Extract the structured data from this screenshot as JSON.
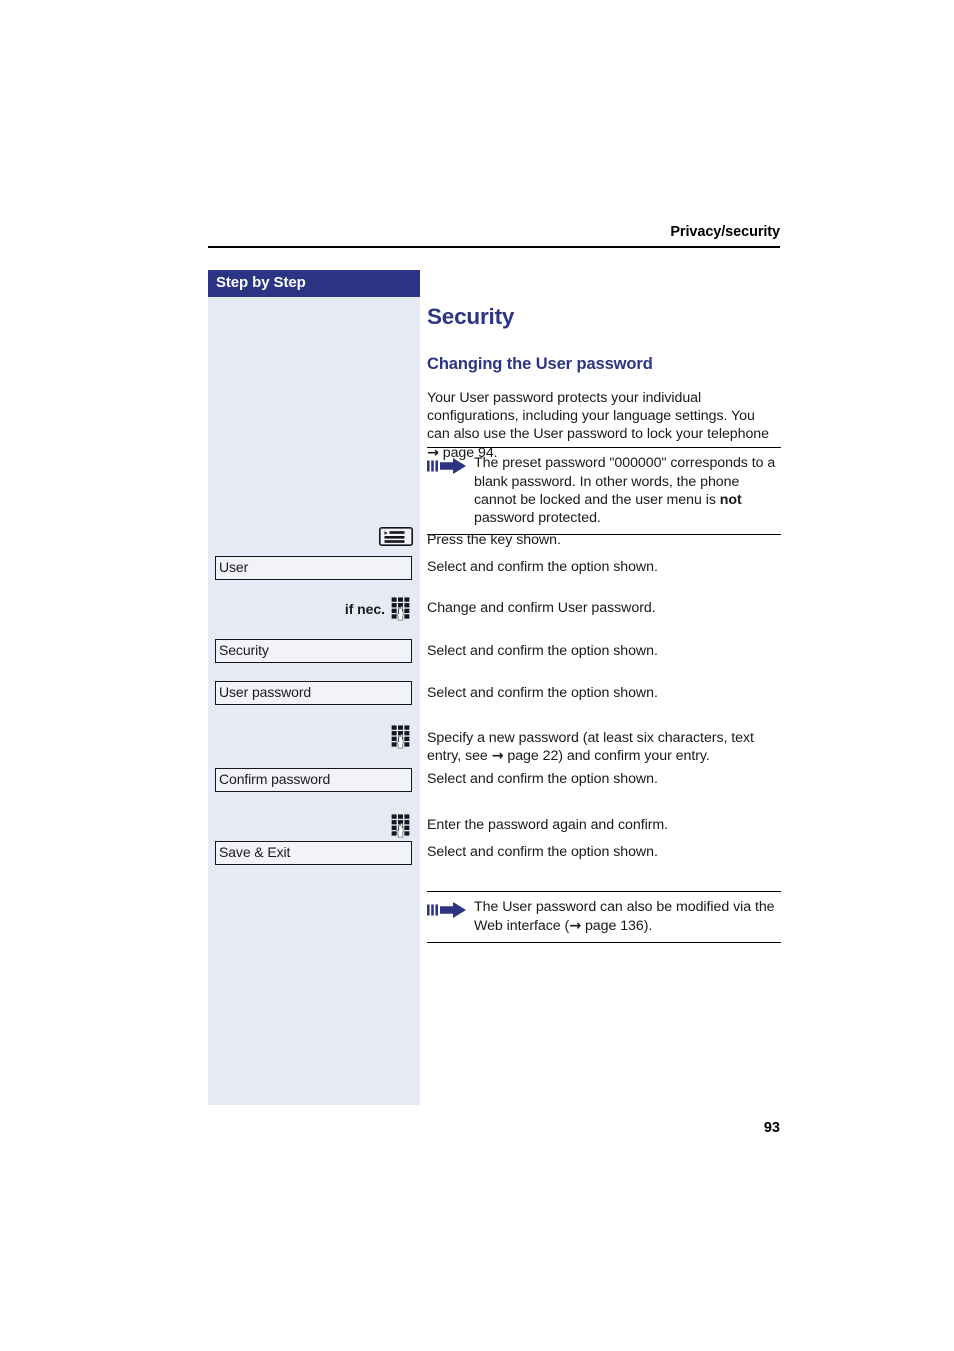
{
  "document": {
    "running_header": "Privacy/security",
    "page_number": "93",
    "accent_color": "#2b3584",
    "sidebar_bg": "#e6eaf5"
  },
  "sidebar": {
    "title": "Step by Step"
  },
  "main": {
    "heading": "Security",
    "subheading": "Changing the User password",
    "intro_paragraph": "Your User password protects your individual configurations, including your language settings. You can also use the User password to lock your telephone → page 94.",
    "notes": [
      {
        "icon": "blue-arrow-icon",
        "text_parts": [
          {
            "text": "The preset password \"000000\" corresponds to a blank password. In other words, the phone cannot be locked and the user menu is ",
            "bold": false
          },
          {
            "text": "not",
            "bold": true
          },
          {
            "text": " password protected.",
            "bold": false
          }
        ],
        "text": "The preset password \"000000\" corresponds to a blank password. In other words, the phone cannot be locked and the user menu is not password protected."
      },
      {
        "icon": "blue-arrow-icon",
        "text_parts": [
          {
            "text": "The User password can also be modified via the Web interface (→ page 136).",
            "bold": false
          }
        ],
        "text": "The User password can also be modified via the Web interface (→ page 136)."
      }
    ],
    "steps": [
      {
        "left_kind": "key-icon",
        "left_icon": "menu-key-icon",
        "left_label": "",
        "prefix": "",
        "description": "Press the key shown."
      },
      {
        "left_kind": "menu-box",
        "left_icon": "",
        "left_label": "User",
        "prefix": "",
        "description": "Select and confirm the option shown."
      },
      {
        "left_kind": "keypad-icon",
        "left_icon": "keypad-icon",
        "left_label": "",
        "prefix": "if nec.",
        "description": "Change and confirm User password."
      },
      {
        "left_kind": "menu-box",
        "left_icon": "",
        "left_label": "Security",
        "prefix": "",
        "description": "Select and confirm the option shown."
      },
      {
        "left_kind": "menu-box",
        "left_icon": "",
        "left_label": "User password",
        "prefix": "",
        "description": "Select and confirm the option shown."
      },
      {
        "left_kind": "keypad-icon",
        "left_icon": "keypad-icon",
        "left_label": "",
        "prefix": "",
        "description": "Specify a new password (at least six characters, text entry, see → page 22) and confirm your entry."
      },
      {
        "left_kind": "menu-box",
        "left_icon": "",
        "left_label": "Confirm password",
        "prefix": "",
        "description": "Select and confirm the option shown."
      },
      {
        "left_kind": "keypad-icon",
        "left_icon": "keypad-icon",
        "left_label": "",
        "prefix": "",
        "description": "Enter the password again and confirm."
      },
      {
        "left_kind": "menu-box",
        "left_icon": "",
        "left_label": "Save & Exit",
        "prefix": "",
        "description": "Select and confirm the option shown."
      }
    ]
  }
}
